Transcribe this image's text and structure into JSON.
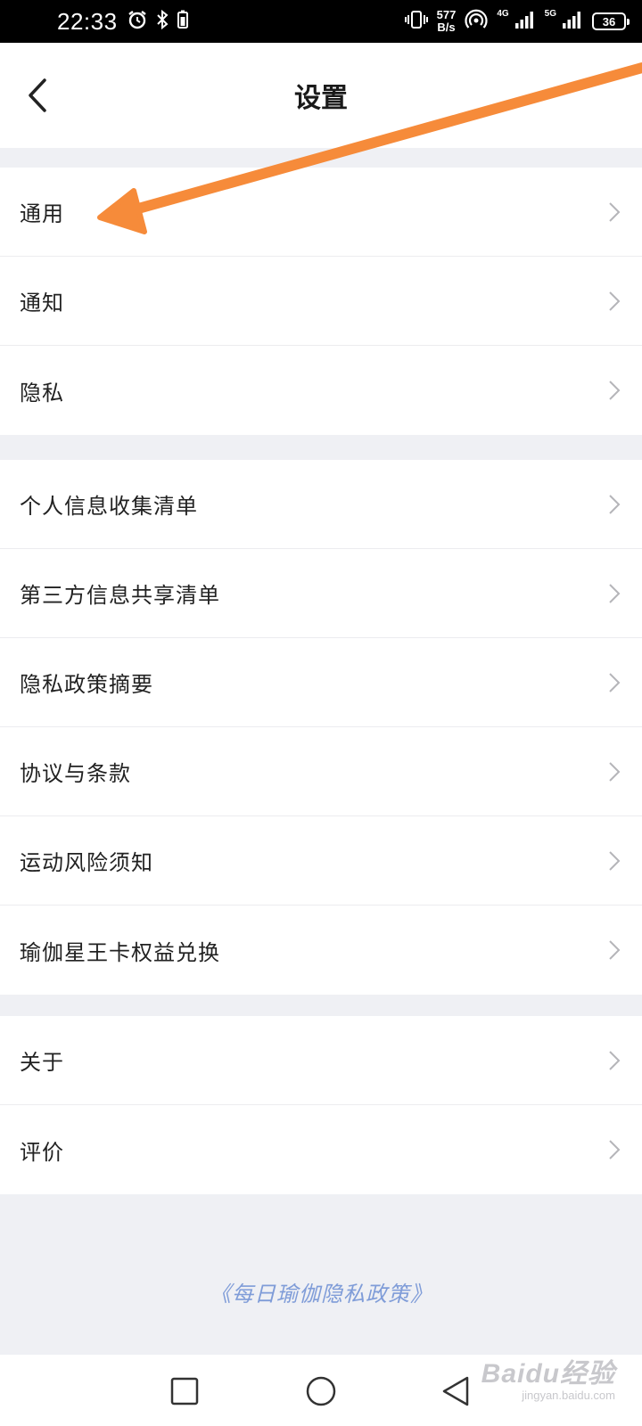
{
  "status_bar": {
    "time": "22:33",
    "net_speed_value": "577",
    "net_speed_unit": "B/s",
    "signal1_label": "4G",
    "signal2_label": "5G",
    "battery_level": "36",
    "icons": [
      "alarm-icon",
      "bluetooth-icon",
      "battery-saver-icon",
      "vibrate-icon",
      "hotspot-icon",
      "signal-icon",
      "signal-icon",
      "battery-icon"
    ]
  },
  "header": {
    "title": "设置",
    "back_icon": "chevron-left-icon"
  },
  "groups": [
    {
      "items": [
        {
          "label": "通用"
        },
        {
          "label": "通知"
        },
        {
          "label": "隐私"
        }
      ]
    },
    {
      "items": [
        {
          "label": "个人信息收集清单"
        },
        {
          "label": "第三方信息共享清单"
        },
        {
          "label": "隐私政策摘要"
        },
        {
          "label": "协议与条款"
        },
        {
          "label": "运动风险须知"
        },
        {
          "label": "瑜伽星王卡权益兑换"
        }
      ]
    },
    {
      "items": [
        {
          "label": "关于"
        },
        {
          "label": "评价"
        }
      ]
    }
  ],
  "footer": {
    "policy_link": "《每日瑜伽隐私政策》"
  },
  "nav_bar": {
    "buttons": [
      "recent-apps",
      "home",
      "back"
    ]
  },
  "watermark": {
    "brand": "Baidu经验",
    "url": "jingyan.baidu.com"
  },
  "colors": {
    "accent_link": "#7f9cd8",
    "annotation_arrow": "#f68b3a",
    "page_bg": "#eff0f4"
  }
}
